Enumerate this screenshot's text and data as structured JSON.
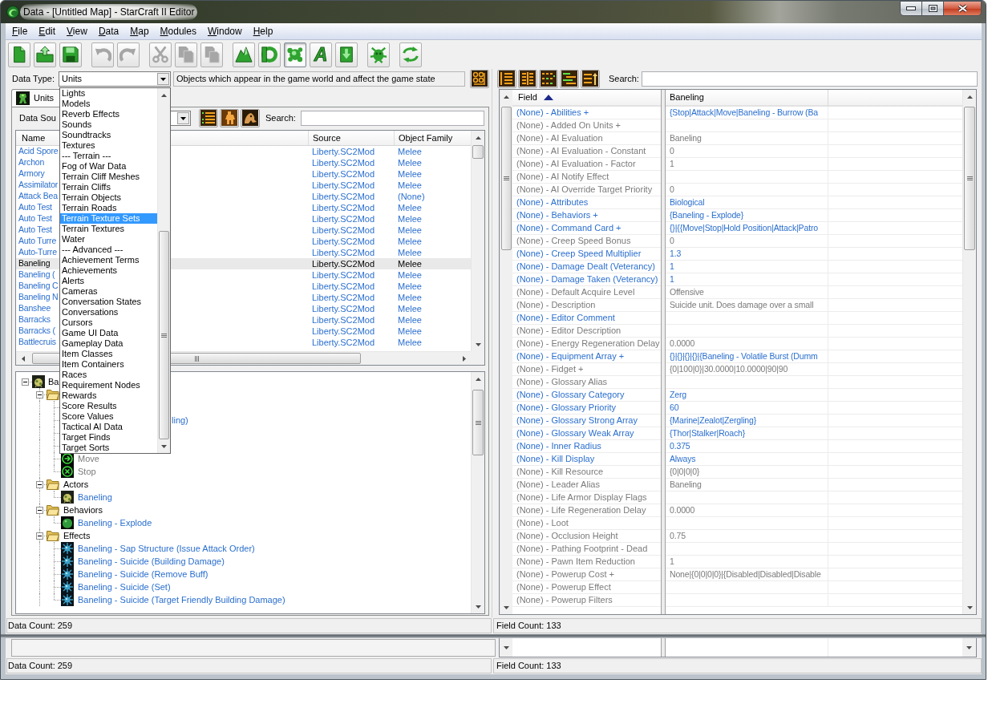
{
  "window": {
    "title": "Data - [Untitled Map] - StarCraft II Editor"
  },
  "menu": [
    "File",
    "Edit",
    "View",
    "Data",
    "Map",
    "Modules",
    "Window",
    "Help"
  ],
  "toolbar": [
    [
      {
        "kind": "page",
        "disabled": false,
        "selected": false
      },
      {
        "kind": "folder-up",
        "disabled": false,
        "selected": false
      },
      {
        "kind": "floppy",
        "disabled": false,
        "selected": false
      }
    ],
    [
      {
        "kind": "undo",
        "disabled": true,
        "selected": false
      },
      {
        "kind": "redo",
        "disabled": true,
        "selected": false
      }
    ],
    [
      {
        "kind": "scissors",
        "disabled": true,
        "selected": false
      },
      {
        "kind": "copy",
        "disabled": true,
        "selected": false
      },
      {
        "kind": "paste",
        "disabled": true,
        "selected": false
      }
    ],
    [
      {
        "kind": "mountains",
        "disabled": false,
        "selected": false
      },
      {
        "kind": "ring",
        "disabled": false,
        "selected": false
      },
      {
        "kind": "splat",
        "disabled": false,
        "selected": true
      },
      {
        "kind": "glyph",
        "label": "A",
        "disabled": false,
        "selected": false
      },
      {
        "kind": "box-down",
        "disabled": false,
        "selected": false
      }
    ],
    [
      {
        "kind": "creature",
        "disabled": false,
        "selected": false
      }
    ],
    [
      {
        "kind": "swirl",
        "disabled": false,
        "selected": false
      }
    ]
  ],
  "data_type": {
    "label": "Data Type:",
    "value": "Units",
    "description": "Objects which appear in the game world and affect the game state",
    "options": [
      {
        "label": "Lights",
        "selected": false
      },
      {
        "label": "Models",
        "selected": false
      },
      {
        "label": "Reverb Effects",
        "selected": false
      },
      {
        "label": "Sounds",
        "selected": false
      },
      {
        "label": "Soundtracks",
        "selected": false
      },
      {
        "label": "Textures",
        "selected": false
      },
      {
        "label": "--- Terrain ---",
        "selected": false
      },
      {
        "label": "Fog of War Data",
        "selected": false
      },
      {
        "label": "Terrain Cliff Meshes",
        "selected": false
      },
      {
        "label": "Terrain Cliffs",
        "selected": false
      },
      {
        "label": "Terrain Objects",
        "selected": false
      },
      {
        "label": "Terrain Roads",
        "selected": false
      },
      {
        "label": "Terrain Texture Sets",
        "selected": true
      },
      {
        "label": "Terrain Textures",
        "selected": false
      },
      {
        "label": "Water",
        "selected": false
      },
      {
        "label": "--- Advanced ---",
        "selected": false
      },
      {
        "label": "Achievement Terms",
        "selected": false
      },
      {
        "label": "Achievements",
        "selected": false
      },
      {
        "label": "Alerts",
        "selected": false
      },
      {
        "label": "Cameras",
        "selected": false
      },
      {
        "label": "Conversation States",
        "selected": false
      },
      {
        "label": "Conversations",
        "selected": false
      },
      {
        "label": "Cursors",
        "selected": false
      },
      {
        "label": "Game UI Data",
        "selected": false
      },
      {
        "label": "Gameplay Data",
        "selected": false
      },
      {
        "label": "Item Classes",
        "selected": false
      },
      {
        "label": "Item Containers",
        "selected": false
      },
      {
        "label": "Races",
        "selected": false
      },
      {
        "label": "Requirement Nodes",
        "selected": false
      },
      {
        "label": "Rewards",
        "selected": false
      },
      {
        "label": "Score Results",
        "selected": false
      },
      {
        "label": "Score Values",
        "selected": false
      },
      {
        "label": "Tactical AI Data",
        "selected": false
      },
      {
        "label": "Target Finds",
        "selected": false
      },
      {
        "label": "Target Sorts",
        "selected": false
      }
    ]
  },
  "tabs": [
    {
      "label": "Units",
      "selected": true
    }
  ],
  "data_source": {
    "label": "Data Sou"
  },
  "units_search": {
    "label": "Search:"
  },
  "units_table": {
    "columns": [
      "Name",
      "Source",
      "Object Family"
    ],
    "rows": [
      {
        "name": "Acid Spore",
        "source": "Liberty.SC2Mod",
        "family": "Melee",
        "selected": false
      },
      {
        "name": "Archon",
        "source": "Liberty.SC2Mod",
        "family": "Melee",
        "selected": false
      },
      {
        "name": "Armory",
        "source": "Liberty.SC2Mod",
        "family": "Melee",
        "selected": false
      },
      {
        "name": "Assimilator",
        "source": "Liberty.SC2Mod",
        "family": "Melee",
        "selected": false
      },
      {
        "name": "Attack Bea",
        "source": "Liberty.SC2Mod",
        "family": "(None)",
        "selected": false
      },
      {
        "name": "Auto Test",
        "source": "Liberty.SC2Mod",
        "family": "Melee",
        "selected": false
      },
      {
        "name": "Auto Test",
        "source": "Liberty.SC2Mod",
        "family": "Melee",
        "selected": false
      },
      {
        "name": "Auto Test",
        "source": "Liberty.SC2Mod",
        "family": "Melee",
        "selected": false
      },
      {
        "name": "Auto Turre",
        "source": "Liberty.SC2Mod",
        "family": "Melee",
        "selected": false
      },
      {
        "name": "Auto-Turre",
        "source": "Liberty.SC2Mod",
        "family": "Melee",
        "selected": false
      },
      {
        "name": "Baneling",
        "source": "Liberty.SC2Mod",
        "family": "Melee",
        "selected": true
      },
      {
        "name": "Baneling (",
        "source": "Liberty.SC2Mod",
        "family": "Melee",
        "selected": false
      },
      {
        "name": "Baneling C",
        "source": "Liberty.SC2Mod",
        "family": "Melee",
        "selected": false
      },
      {
        "name": "Baneling N",
        "source": "Liberty.SC2Mod",
        "family": "Melee",
        "selected": false
      },
      {
        "name": "Banshee",
        "source": "Liberty.SC2Mod",
        "family": "Melee",
        "selected": false
      },
      {
        "name": "Barracks",
        "source": "Liberty.SC2Mod",
        "family": "Melee",
        "selected": false
      },
      {
        "name": "Barracks (",
        "source": "Liberty.SC2Mod",
        "family": "Melee",
        "selected": false
      },
      {
        "name": "Battlecruis",
        "source": "Liberty.SC2Mod",
        "family": "Melee",
        "selected": false
      }
    ]
  },
  "tree": [
    {
      "kind": "unit",
      "label": "Ba",
      "expanded": true,
      "children": [
        {
          "kind": "folder",
          "expanded": true,
          "children": [
            {
              "kind": "covered"
            },
            {
              "kind": "covered",
              "label": "ling)",
              "modified": true
            },
            {
              "kind": "covered"
            },
            {
              "kind": "covered"
            },
            {
              "kind": "move",
              "label": "Move",
              "modified": false
            },
            {
              "kind": "stop",
              "label": "Stop",
              "modified": false
            }
          ]
        },
        {
          "kind": "folder",
          "label": "Actors",
          "expanded": true,
          "children": [
            {
              "kind": "unit",
              "label": "Baneling",
              "modified": true
            }
          ]
        },
        {
          "kind": "folder",
          "label": "Behaviors",
          "expanded": true,
          "children": [
            {
              "kind": "blob",
              "label": "Baneling - Explode",
              "modified": true
            }
          ]
        },
        {
          "kind": "folder",
          "label": "Effects",
          "expanded": true,
          "children": [
            {
              "kind": "splash",
              "label": "Baneling - Sap Structure (Issue Attack Order)",
              "modified": true
            },
            {
              "kind": "splash",
              "label": "Baneling - Suicide (Building Damage)",
              "modified": true
            },
            {
              "kind": "splash",
              "label": "Baneling - Suicide (Remove Buff)",
              "modified": true
            },
            {
              "kind": "splash",
              "label": "Baneling - Suicide (Set)",
              "modified": true
            },
            {
              "kind": "splash",
              "label": "Baneling - Suicide (Target Friendly Building Damage)",
              "modified": true
            }
          ]
        }
      ]
    }
  ],
  "fields_search": {
    "label": "Search:"
  },
  "fields_table": {
    "columns": [
      {
        "label": "Field",
        "sort_ascending": true
      },
      {
        "label": "Baneling"
      }
    ],
    "rows": [
      {
        "field": "(None) - Abilities +",
        "value": "{Stop|Attack|Move|Baneling - Burrow (Ba",
        "modified": true
      },
      {
        "field": "(None) - Added On Units +",
        "modified": false
      },
      {
        "field": "(None) - AI Evaluation",
        "value": "Baneling",
        "modified": false
      },
      {
        "field": "(None) - AI Evaluation - Constant",
        "value": "0",
        "modified": false
      },
      {
        "field": "(None) - AI Evaluation - Factor",
        "value": "1",
        "modified": false
      },
      {
        "field": "(None) - AI Notify Effect",
        "modified": false
      },
      {
        "field": "(None) - AI Override Target Priority",
        "value": "0",
        "modified": false
      },
      {
        "field": "(None) - Attributes",
        "value": "Biological",
        "modified": true
      },
      {
        "field": "(None) - Behaviors +",
        "value": "{Baneling - Explode}",
        "modified": true
      },
      {
        "field": "(None) - Command Card +",
        "value": "{}|{{Move|Stop|Hold Position|Attack|Patro",
        "modified": true
      },
      {
        "field": "(None) - Creep Speed Bonus",
        "value": "0",
        "modified": false
      },
      {
        "field": "(None) - Creep Speed Multiplier",
        "value": "1.3",
        "modified": true
      },
      {
        "field": "(None) - Damage Dealt (Veterancy)",
        "value": "1",
        "modified": true
      },
      {
        "field": "(None) - Damage Taken (Veterancy)",
        "value": "1",
        "modified": true
      },
      {
        "field": "(None) - Default Acquire Level",
        "value": "Offensive",
        "modified": false
      },
      {
        "field": "(None) - Description",
        "value": "Suicide unit. Does damage over a small",
        "modified": false
      },
      {
        "field": "(None) - Editor Comment",
        "modified": true
      },
      {
        "field": "(None) - Editor Description",
        "modified": false
      },
      {
        "field": "(None) - Energy Regeneration Delay",
        "value": "0.0000",
        "modified": false
      },
      {
        "field": "(None) - Equipment Array +",
        "value": "{}|{}|{}|{}|{Baneling - Volatile Burst (Dumm",
        "modified": true
      },
      {
        "field": "(None) - Fidget +",
        "value": "{0|100|0}|30.0000|10.0000|90|90",
        "modified": false
      },
      {
        "field": "(None) - Glossary Alias",
        "modified": false
      },
      {
        "field": "(None) - Glossary Category",
        "value": "Zerg",
        "modified": true
      },
      {
        "field": "(None) - Glossary Priority",
        "value": "60",
        "modified": true
      },
      {
        "field": "(None) - Glossary Strong Array",
        "value": "{Marine|Zealot|Zergling}",
        "modified": true
      },
      {
        "field": "(None) - Glossary Weak Array",
        "value": "{Thor|Stalker|Roach}",
        "modified": true
      },
      {
        "field": "(None) - Inner Radius",
        "value": "0.375",
        "modified": true
      },
      {
        "field": "(None) - Kill Display",
        "value": "Always",
        "modified": true
      },
      {
        "field": "(None) - Kill Resource",
        "value": "{0|0|0|0}",
        "modified": false
      },
      {
        "field": "(None) - Leader Alias",
        "value": "Baneling",
        "modified": false
      },
      {
        "field": "(None) - Life Armor Display Flags",
        "modified": false
      },
      {
        "field": "(None) - Life Regeneration Delay",
        "value": "0.0000",
        "modified": false
      },
      {
        "field": "(None) - Loot",
        "modified": false
      },
      {
        "field": "(None) - Occlusion Height",
        "value": "0.75",
        "modified": false
      },
      {
        "field": "(None) - Pathing Footprint - Dead",
        "modified": false
      },
      {
        "field": "(None) - Pawn Item Reduction",
        "value": "1",
        "modified": false
      },
      {
        "field": "(None) - Powerup Cost +",
        "value": "None|{0|0|0|0}|{Disabled|Disabled|Disable",
        "modified": false
      },
      {
        "field": "(None) - Powerup Effect",
        "modified": false
      },
      {
        "field": "(None) - Powerup Filters",
        "modified": false
      }
    ]
  },
  "status_bar": {
    "data_count": "Data Count: 259",
    "field_count": "Field Count: 133"
  },
  "lower_status_bar": {
    "data_count": "Data Count: 259",
    "field_count": "Field Count: 133"
  }
}
